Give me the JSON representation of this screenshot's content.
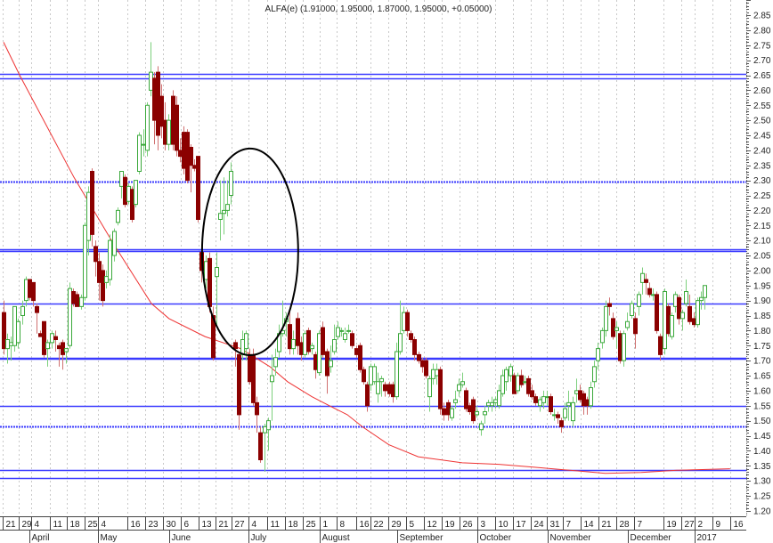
{
  "chart_data": {
    "type": "candlestick",
    "title": "ALFA(e) (1.91000, 1.95000, 1.87000, 1.95000, +0.05000)",
    "ylim": [
      1.2,
      2.85
    ],
    "y_ticks": [
      "2.85",
      "2.80",
      "2.75",
      "2.70",
      "2.65",
      "2.60",
      "2.55",
      "2.50",
      "2.45",
      "2.40",
      "2.35",
      "2.30",
      "2.25",
      "2.20",
      "2.15",
      "2.10",
      "2.05",
      "2.00",
      "1.95",
      "1.90",
      "1.85",
      "1.80",
      "1.75",
      "1.70",
      "1.65",
      "1.60",
      "1.55",
      "1.50",
      "1.45",
      "1.40",
      "1.35",
      "1.30",
      "1.25",
      "1.20"
    ],
    "colors": {
      "up": "#3aa83a",
      "up_wick": "#7ccf7c",
      "down": "#8b0000",
      "down_wick": "#d07070",
      "levels": "#3a3aff",
      "moving_average": "#ee3333",
      "annotation": "#000000"
    },
    "candles_ohlc": [
      [
        1.86,
        1.9,
        1.72,
        1.74
      ],
      [
        1.74,
        1.79,
        1.69,
        1.77
      ],
      [
        1.75,
        1.78,
        1.7,
        1.76
      ],
      [
        1.75,
        1.88,
        1.73,
        1.88
      ],
      [
        1.76,
        1.84,
        1.74,
        1.83
      ],
      [
        1.85,
        1.9,
        1.82,
        1.88
      ],
      [
        1.9,
        1.98,
        1.88,
        1.97
      ],
      [
        1.97,
        1.97,
        1.9,
        1.91
      ],
      [
        1.96,
        1.96,
        1.88,
        1.9
      ],
      [
        1.88,
        1.89,
        1.79,
        1.86
      ],
      [
        1.79,
        1.8,
        1.78,
        1.78
      ],
      [
        1.83,
        1.83,
        1.71,
        1.72
      ],
      [
        1.74,
        1.77,
        1.68,
        1.76
      ],
      [
        1.76,
        1.8,
        1.74,
        1.79
      ],
      [
        1.78,
        1.8,
        1.73,
        1.77
      ],
      [
        1.75,
        1.76,
        1.68,
        1.74
      ],
      [
        1.76,
        1.77,
        1.67,
        1.72
      ],
      [
        1.73,
        1.74,
        1.69,
        1.74
      ],
      [
        1.75,
        1.96,
        1.74,
        1.94
      ],
      [
        1.93,
        1.94,
        1.88,
        1.89
      ],
      [
        1.92,
        1.93,
        1.88,
        1.88
      ],
      [
        1.88,
        1.92,
        1.87,
        1.91
      ],
      [
        1.91,
        2.16,
        1.9,
        2.15
      ],
      [
        2.1,
        2.28,
        2.05,
        2.26
      ],
      [
        2.33,
        2.34,
        2.08,
        2.12
      ],
      [
        2.08,
        2.1,
        1.98,
        2.03
      ],
      [
        2.03,
        2.06,
        1.9,
        1.96
      ],
      [
        2.0,
        2.02,
        1.88,
        1.9
      ],
      [
        1.96,
        2.0,
        1.94,
        1.98
      ],
      [
        1.97,
        2.12,
        1.95,
        2.1
      ],
      [
        2.05,
        2.14,
        2.03,
        2.13
      ],
      [
        2.16,
        2.21,
        2.15,
        2.2
      ],
      [
        2.28,
        2.33,
        2.24,
        2.33
      ],
      [
        2.31,
        2.32,
        2.21,
        2.22
      ],
      [
        2.23,
        2.29,
        2.22,
        2.28
      ],
      [
        2.27,
        2.28,
        2.16,
        2.17
      ],
      [
        2.22,
        2.3,
        2.21,
        2.3
      ],
      [
        2.33,
        2.46,
        2.32,
        2.45
      ],
      [
        2.42,
        2.47,
        2.38,
        2.42
      ],
      [
        2.4,
        2.56,
        2.38,
        2.55
      ],
      [
        2.6,
        2.76,
        2.58,
        2.66
      ],
      [
        2.64,
        2.66,
        2.42,
        2.5
      ],
      [
        2.66,
        2.68,
        2.4,
        2.45
      ],
      [
        2.58,
        2.62,
        2.44,
        2.48
      ],
      [
        2.5,
        2.56,
        2.4,
        2.42
      ],
      [
        2.42,
        2.52,
        2.4,
        2.5
      ],
      [
        2.58,
        2.6,
        2.4,
        2.42
      ],
      [
        2.55,
        2.58,
        2.38,
        2.4
      ],
      [
        2.4,
        2.44,
        2.36,
        2.38
      ],
      [
        2.46,
        2.48,
        2.32,
        2.34
      ],
      [
        2.46,
        2.47,
        2.29,
        2.3
      ],
      [
        2.41,
        2.42,
        2.26,
        2.35
      ],
      [
        2.35,
        2.37,
        2.33,
        2.34
      ],
      [
        2.38,
        2.38,
        2.16,
        2.17
      ],
      [
        2.06,
        2.08,
        1.96,
        2.0
      ],
      [
        1.97,
        2.05,
        1.94,
        2.03
      ],
      [
        2.04,
        2.06,
        1.86,
        1.88
      ],
      [
        1.85,
        1.88,
        1.7,
        1.71
      ],
      [
        1.98,
        2.06,
        1.82,
        2.01
      ],
      [
        2.17,
        2.3,
        2.1,
        2.19
      ],
      [
        2.19,
        2.31,
        2.12,
        2.2
      ],
      [
        2.2,
        2.3,
        2.18,
        2.22
      ],
      [
        2.25,
        2.36,
        2.22,
        2.33
      ],
      [
        1.76,
        1.77,
        1.68,
        1.74
      ],
      [
        1.72,
        1.73,
        1.47,
        1.52
      ],
      [
        1.72,
        1.8,
        1.7,
        1.77
      ],
      [
        1.74,
        1.8,
        1.7,
        1.79
      ],
      [
        1.72,
        1.74,
        1.62,
        1.63
      ],
      [
        1.72,
        1.74,
        1.55,
        1.56
      ],
      [
        1.56,
        1.58,
        1.46,
        1.52
      ],
      [
        1.46,
        1.48,
        1.36,
        1.37
      ],
      [
        1.46,
        1.49,
        1.33,
        1.48
      ],
      [
        1.47,
        1.51,
        1.4,
        1.5
      ],
      [
        1.63,
        1.72,
        1.5,
        1.65
      ],
      [
        1.68,
        1.74,
        1.65,
        1.71
      ],
      [
        1.73,
        1.82,
        1.71,
        1.79
      ],
      [
        1.79,
        1.9,
        1.78,
        1.8
      ],
      [
        1.83,
        1.86,
        1.78,
        1.84
      ],
      [
        1.82,
        1.87,
        1.72,
        1.74
      ],
      [
        1.74,
        1.8,
        1.72,
        1.77
      ],
      [
        1.84,
        1.86,
        1.72,
        1.75
      ],
      [
        1.76,
        1.78,
        1.7,
        1.72
      ],
      [
        1.72,
        1.8,
        1.71,
        1.79
      ],
      [
        1.8,
        1.81,
        1.72,
        1.73
      ],
      [
        1.74,
        1.76,
        1.72,
        1.75
      ],
      [
        1.72,
        1.73,
        1.64,
        1.67
      ],
      [
        1.66,
        1.8,
        1.65,
        1.79
      ],
      [
        1.81,
        1.83,
        1.71,
        1.72
      ],
      [
        1.73,
        1.74,
        1.59,
        1.65
      ],
      [
        1.68,
        1.75,
        1.66,
        1.7
      ],
      [
        1.73,
        1.82,
        1.72,
        1.77
      ],
      [
        1.78,
        1.83,
        1.77,
        1.81
      ],
      [
        1.8,
        1.81,
        1.78,
        1.8
      ],
      [
        1.77,
        1.81,
        1.76,
        1.79
      ],
      [
        1.8,
        1.82,
        1.79,
        1.8
      ],
      [
        1.79,
        1.8,
        1.74,
        1.75
      ],
      [
        1.74,
        1.75,
        1.71,
        1.72
      ],
      [
        1.75,
        1.76,
        1.66,
        1.67
      ],
      [
        1.67,
        1.68,
        1.62,
        1.63
      ],
      [
        1.62,
        1.63,
        1.53,
        1.55
      ],
      [
        1.62,
        1.69,
        1.6,
        1.68
      ],
      [
        1.63,
        1.69,
        1.62,
        1.68
      ],
      [
        1.59,
        1.66,
        1.56,
        1.63
      ],
      [
        1.63,
        1.65,
        1.58,
        1.64
      ],
      [
        1.62,
        1.63,
        1.58,
        1.6
      ],
      [
        1.62,
        1.63,
        1.58,
        1.59
      ],
      [
        1.62,
        1.63,
        1.56,
        1.58
      ],
      [
        1.58,
        1.76,
        1.57,
        1.73
      ],
      [
        1.73,
        1.9,
        1.72,
        1.79
      ],
      [
        1.8,
        1.88,
        1.79,
        1.86
      ],
      [
        1.86,
        1.87,
        1.78,
        1.8
      ],
      [
        1.79,
        1.8,
        1.76,
        1.77
      ],
      [
        1.77,
        1.78,
        1.7,
        1.72
      ],
      [
        1.72,
        1.73,
        1.69,
        1.7
      ],
      [
        1.7,
        1.71,
        1.66,
        1.68
      ],
      [
        1.7,
        1.71,
        1.64,
        1.65
      ],
      [
        1.58,
        1.65,
        1.53,
        1.64
      ],
      [
        1.64,
        1.69,
        1.62,
        1.67
      ],
      [
        1.65,
        1.69,
        1.62,
        1.67
      ],
      [
        1.67,
        1.68,
        1.52,
        1.54
      ],
      [
        1.54,
        1.56,
        1.5,
        1.52
      ],
      [
        1.56,
        1.57,
        1.5,
        1.52
      ],
      [
        1.51,
        1.55,
        1.5,
        1.54
      ],
      [
        1.56,
        1.6,
        1.54,
        1.57
      ],
      [
        1.6,
        1.64,
        1.58,
        1.62
      ],
      [
        1.62,
        1.66,
        1.61,
        1.63
      ],
      [
        1.6,
        1.61,
        1.53,
        1.54
      ],
      [
        1.55,
        1.56,
        1.52,
        1.53
      ],
      [
        1.57,
        1.58,
        1.49,
        1.5
      ],
      [
        1.52,
        1.55,
        1.51,
        1.53
      ],
      [
        1.47,
        1.5,
        1.45,
        1.49
      ],
      [
        1.52,
        1.55,
        1.49,
        1.53
      ],
      [
        1.55,
        1.57,
        1.53,
        1.56
      ],
      [
        1.55,
        1.58,
        1.53,
        1.56
      ],
      [
        1.56,
        1.58,
        1.54,
        1.57
      ],
      [
        1.55,
        1.62,
        1.54,
        1.6
      ],
      [
        1.59,
        1.67,
        1.58,
        1.65
      ],
      [
        1.63,
        1.68,
        1.6,
        1.67
      ],
      [
        1.65,
        1.69,
        1.63,
        1.68
      ],
      [
        1.65,
        1.66,
        1.59,
        1.59
      ],
      [
        1.6,
        1.66,
        1.59,
        1.65
      ],
      [
        1.65,
        1.67,
        1.61,
        1.62
      ],
      [
        1.63,
        1.65,
        1.62,
        1.63
      ],
      [
        1.64,
        1.65,
        1.58,
        1.59
      ],
      [
        1.6,
        1.62,
        1.57,
        1.58
      ],
      [
        1.58,
        1.59,
        1.55,
        1.56
      ],
      [
        1.55,
        1.58,
        1.53,
        1.57
      ],
      [
        1.56,
        1.6,
        1.54,
        1.58
      ],
      [
        1.58,
        1.6,
        1.55,
        1.58
      ],
      [
        1.58,
        1.59,
        1.52,
        1.53
      ],
      [
        1.52,
        1.54,
        1.5,
        1.52
      ],
      [
        1.52,
        1.53,
        1.49,
        1.51
      ],
      [
        1.5,
        1.51,
        1.46,
        1.48
      ],
      [
        1.51,
        1.56,
        1.5,
        1.54
      ],
      [
        1.55,
        1.6,
        1.5,
        1.56
      ],
      [
        1.5,
        1.58,
        1.48,
        1.56
      ],
      [
        1.59,
        1.64,
        1.56,
        1.6
      ],
      [
        1.6,
        1.62,
        1.56,
        1.57
      ],
      [
        1.59,
        1.6,
        1.52,
        1.55
      ],
      [
        1.57,
        1.58,
        1.52,
        1.55
      ],
      [
        1.55,
        1.63,
        1.54,
        1.61
      ],
      [
        1.63,
        1.7,
        1.61,
        1.68
      ],
      [
        1.7,
        1.76,
        1.67,
        1.74
      ],
      [
        1.76,
        1.81,
        1.74,
        1.8
      ],
      [
        1.8,
        1.9,
        1.78,
        1.88
      ],
      [
        1.89,
        1.91,
        1.85,
        1.88
      ],
      [
        1.84,
        1.86,
        1.77,
        1.78
      ],
      [
        1.8,
        1.83,
        1.74,
        1.81
      ],
      [
        1.79,
        1.8,
        1.69,
        1.7
      ],
      [
        1.7,
        1.8,
        1.68,
        1.79
      ],
      [
        1.81,
        1.86,
        1.8,
        1.83
      ],
      [
        1.85,
        1.9,
        1.84,
        1.89
      ],
      [
        1.84,
        1.86,
        1.74,
        1.79
      ],
      [
        1.88,
        1.93,
        1.85,
        1.92
      ],
      [
        1.96,
        2.01,
        1.92,
        1.99
      ],
      [
        1.97,
        1.99,
        1.92,
        1.96
      ],
      [
        1.94,
        1.96,
        1.91,
        1.92
      ],
      [
        1.92,
        1.94,
        1.9,
        1.92
      ],
      [
        1.92,
        1.93,
        1.79,
        1.8
      ],
      [
        1.78,
        1.79,
        1.7,
        1.72
      ],
      [
        1.74,
        1.94,
        1.72,
        1.93
      ],
      [
        1.88,
        1.89,
        1.78,
        1.79
      ],
      [
        1.78,
        1.86,
        1.77,
        1.85
      ],
      [
        1.88,
        1.93,
        1.86,
        1.92
      ],
      [
        1.91,
        1.92,
        1.82,
        1.84
      ],
      [
        1.84,
        1.87,
        1.8,
        1.86
      ],
      [
        1.89,
        1.97,
        1.88,
        1.93
      ],
      [
        1.88,
        1.92,
        1.82,
        1.83
      ],
      [
        1.84,
        1.86,
        1.81,
        1.82
      ],
      [
        1.82,
        1.91,
        1.81,
        1.9
      ],
      [
        1.9,
        1.93,
        1.87,
        1.91
      ],
      [
        1.91,
        1.95,
        1.87,
        1.95
      ]
    ],
    "moving_average": [
      [
        0,
        2.76
      ],
      [
        4.4,
        2.65
      ],
      [
        19.2,
        2.31
      ],
      [
        29.9,
        2.09
      ],
      [
        40.3,
        1.89
      ],
      [
        45.1,
        1.84
      ],
      [
        54.9,
        1.78
      ],
      [
        64.6,
        1.74
      ],
      [
        72.6,
        1.68
      ],
      [
        77.4,
        1.63
      ],
      [
        84,
        1.58
      ],
      [
        88.8,
        1.55
      ],
      [
        93.7,
        1.52
      ],
      [
        97.8,
        1.48
      ],
      [
        105,
        1.42
      ],
      [
        113,
        1.38
      ],
      [
        125,
        1.36
      ],
      [
        135,
        1.355
      ],
      [
        144.7,
        1.345
      ],
      [
        154.4,
        1.335
      ],
      [
        164,
        1.325
      ],
      [
        173.8,
        1.328
      ],
      [
        183.5,
        1.335
      ],
      [
        198,
        1.34
      ]
    ],
    "levels": [
      {
        "price": 2.655,
        "style": "solid"
      },
      {
        "price": 2.64,
        "style": "solid"
      },
      {
        "price": 2.295,
        "style": "dotted"
      },
      {
        "price": 2.07,
        "style": "solid"
      },
      {
        "price": 2.065,
        "style": "solid"
      },
      {
        "price": 1.89,
        "style": "solid"
      },
      {
        "price": 1.71,
        "style": "solid"
      },
      {
        "price": 1.705,
        "style": "solid"
      },
      {
        "price": 1.55,
        "style": "solid"
      },
      {
        "price": 1.48,
        "style": "dotted"
      },
      {
        "price": 1.335,
        "style": "solid"
      },
      {
        "price": 1.31,
        "style": "solid"
      }
    ],
    "annotation_ellipse": {
      "center_index": 67.2,
      "center_price": 2.062,
      "radius_index": 13.1,
      "radius_price": 0.344
    },
    "x_ticks": [
      {
        "label": "21",
        "index": 0.5
      },
      {
        "label": "29",
        "index": 4.9
      },
      {
        "label": "4",
        "index": 8.3
      },
      {
        "label": "11",
        "index": 13.3
      },
      {
        "label": "18",
        "index": 18
      },
      {
        "label": "25",
        "index": 22.8
      },
      {
        "label": "4",
        "index": 26.5
      },
      {
        "label": "16",
        "index": 34.5
      },
      {
        "label": "23",
        "index": 39.3
      },
      {
        "label": "30",
        "index": 44.2
      },
      {
        "label": "6",
        "index": 49
      },
      {
        "label": "13",
        "index": 53.9
      },
      {
        "label": "21",
        "index": 58.5
      },
      {
        "label": "27",
        "index": 62.9
      },
      {
        "label": "4",
        "index": 67.5
      },
      {
        "label": "11",
        "index": 72.6
      },
      {
        "label": "18",
        "index": 77.4
      },
      {
        "label": "25",
        "index": 82.3
      },
      {
        "label": "1",
        "index": 86.9
      },
      {
        "label": "8",
        "index": 91.5
      },
      {
        "label": "16",
        "index": 96.8
      },
      {
        "label": "22",
        "index": 100.7
      },
      {
        "label": "29",
        "index": 105.6
      },
      {
        "label": "5",
        "index": 110.4
      },
      {
        "label": "12",
        "index": 115.3
      },
      {
        "label": "19",
        "index": 120.1
      },
      {
        "label": "26",
        "index": 125
      },
      {
        "label": "3",
        "index": 129.9
      },
      {
        "label": "10",
        "index": 134.7
      },
      {
        "label": "17",
        "index": 139.6
      },
      {
        "label": "24",
        "index": 144.4
      },
      {
        "label": "31",
        "index": 148.8
      },
      {
        "label": "7",
        "index": 153.2
      },
      {
        "label": "14",
        "index": 158
      },
      {
        "label": "21",
        "index": 162.9
      },
      {
        "label": "28",
        "index": 167.7
      },
      {
        "label": "7",
        "index": 172.6
      },
      {
        "label": "19",
        "index": 180.6
      },
      {
        "label": "27",
        "index": 185.4
      },
      {
        "label": "2",
        "index": 189.1
      },
      {
        "label": "9",
        "index": 193.9
      },
      {
        "label": "16",
        "index": 198.8
      }
    ],
    "months": [
      {
        "label": "April",
        "index": 7.8
      },
      {
        "label": "May",
        "index": 26.5
      },
      {
        "label": "June",
        "index": 45.9
      },
      {
        "label": "July",
        "index": 67.5
      },
      {
        "label": "August",
        "index": 86.9
      },
      {
        "label": "September",
        "index": 108
      },
      {
        "label": "October",
        "index": 129.9
      },
      {
        "label": "November",
        "index": 149
      },
      {
        "label": "December",
        "index": 170.9
      },
      {
        "label": "2017",
        "index": 189.1
      }
    ]
  }
}
